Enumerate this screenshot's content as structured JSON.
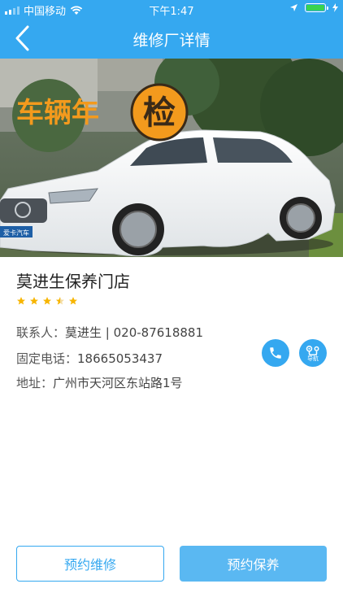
{
  "status_bar": {
    "carrier": "中国移动",
    "time": "下午1:47"
  },
  "nav": {
    "title": "维修厂详情",
    "back_icon": "chevron-left-icon"
  },
  "hero": {
    "banner_text": "车辆年",
    "badge_char": "检",
    "plate_text": "爱卡汽车"
  },
  "store": {
    "name": "莫进生保养门店",
    "rating": 4.5,
    "rating_max": 5,
    "contact_label": "联系人：",
    "contact_value": "莫进生 | 020-87618881",
    "phone_label": "固定电话：",
    "phone_value": "18665053437",
    "address_label": "地址：",
    "address_value": "广州市天河区东站路1号"
  },
  "actions": {
    "call_icon": "phone-icon",
    "navigate_icon": "navigation-icon",
    "navigate_label": "导航",
    "book_repair": "预约维修",
    "book_maintenance": "预约保养"
  },
  "colors": {
    "primary": "#35a8f0",
    "star": "#f7b500",
    "text_dark": "#222222",
    "text_muted": "#555555"
  }
}
